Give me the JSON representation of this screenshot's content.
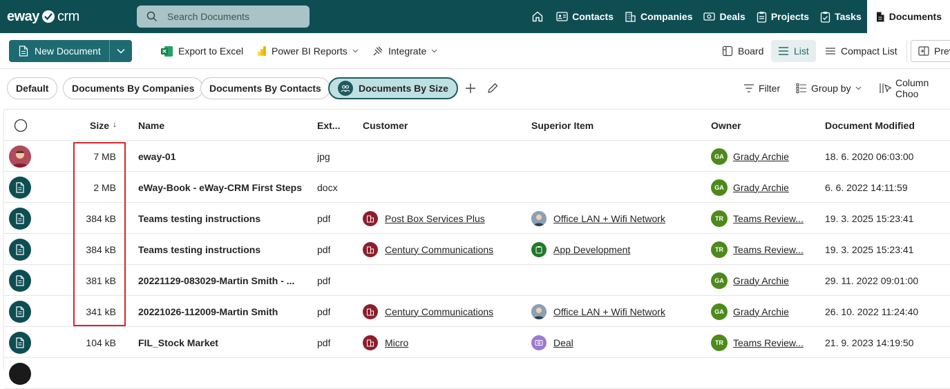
{
  "brand": {
    "name_bold": "eway",
    "name_light": "crm"
  },
  "search": {
    "placeholder": "Search Documents"
  },
  "nav": [
    {
      "label": "Contacts",
      "icon": "contacts-card-icon"
    },
    {
      "label": "Companies",
      "icon": "building-icon"
    },
    {
      "label": "Deals",
      "icon": "deal-icon"
    },
    {
      "label": "Projects",
      "icon": "clipboard-icon"
    },
    {
      "label": "Tasks",
      "icon": "task-icon"
    },
    {
      "label": "Documents",
      "icon": "document-icon",
      "active": true
    }
  ],
  "toolbar": {
    "new_document": "New Document",
    "export_excel": "Export to Excel",
    "power_bi": "Power BI Reports",
    "integrate": "Integrate",
    "board": "Board",
    "list": "List",
    "compact_list": "Compact List",
    "preview": "Prev"
  },
  "views": {
    "items": [
      "Default",
      "Documents By Companies",
      "Documents By Contacts",
      "Documents By Size"
    ],
    "active": "Documents By Size",
    "filter": "Filter",
    "group_by": "Group by",
    "column_chooser": "Column Choo"
  },
  "table": {
    "headers": {
      "size": "Size",
      "sort_indicator": "↓",
      "name": "Name",
      "ext": "Ext...",
      "customer": "Customer",
      "superior": "Superior Item",
      "owner": "Owner",
      "modified": "Document Modified"
    },
    "rows": [
      {
        "avatar": "person",
        "size": "7 MB",
        "name": "eway-01",
        "ext": "jpg",
        "customer": "",
        "superior": "",
        "superior_type": "",
        "owner_initials": "GA",
        "owner": "Grady Archie",
        "modified": "18. 6. 2020 06:03:00"
      },
      {
        "avatar": "doc",
        "size": "2 MB",
        "name": "eWay-Book - eWay-CRM First Steps",
        "ext": "docx",
        "customer": "",
        "superior": "",
        "superior_type": "",
        "owner_initials": "GA",
        "owner": "Grady Archie",
        "modified": "6. 6. 2022 14:11:59"
      },
      {
        "avatar": "doc",
        "size": "384 kB",
        "name": "Teams testing instructions",
        "ext": "pdf",
        "customer": "Post Box Services Plus",
        "superior": "Office LAN + Wifi Network",
        "superior_type": "person",
        "owner_initials": "TR",
        "owner": "Teams Review...",
        "modified": "19. 3. 2025 15:23:41"
      },
      {
        "avatar": "doc",
        "size": "384 kB",
        "name": "Teams testing instructions",
        "ext": "pdf",
        "customer": "Century Communications",
        "superior": "App Development",
        "superior_type": "project",
        "owner_initials": "TR",
        "owner": "Teams Review...",
        "modified": "19. 3. 2025 15:23:41"
      },
      {
        "avatar": "doc",
        "size": "381 kB",
        "name": "20221129-083029-Martin Smith - ...",
        "ext": "pdf",
        "customer": "",
        "superior": "",
        "superior_type": "",
        "owner_initials": "GA",
        "owner": "Grady Archie",
        "modified": "29. 11. 2022 09:01:00"
      },
      {
        "avatar": "doc",
        "size": "341 kB",
        "name": "20221026-112009-Martin Smith",
        "ext": "pdf",
        "customer": "Century Communications",
        "superior": "Office LAN + Wifi Network",
        "superior_type": "person",
        "owner_initials": "GA",
        "owner": "Grady Archie",
        "modified": "26. 10. 2022 11:24:40"
      },
      {
        "avatar": "doc",
        "size": "104 kB",
        "name": "FIL_Stock Market",
        "ext": "pdf",
        "customer": "Micro",
        "superior": "Deal",
        "superior_type": "deal",
        "owner_initials": "TR",
        "owner": "Teams Review...",
        "modified": "21. 9. 2023 14:19:50"
      },
      {
        "avatar": "dark",
        "size": "",
        "name": "",
        "ext": "",
        "customer": "",
        "superior": "",
        "superior_type": "",
        "owner_initials": "",
        "owner": "",
        "modified": ""
      }
    ]
  },
  "colors": {
    "header_bg": "#0e4e53",
    "accent": "#1d6b70",
    "highlight": "#d7262d"
  }
}
